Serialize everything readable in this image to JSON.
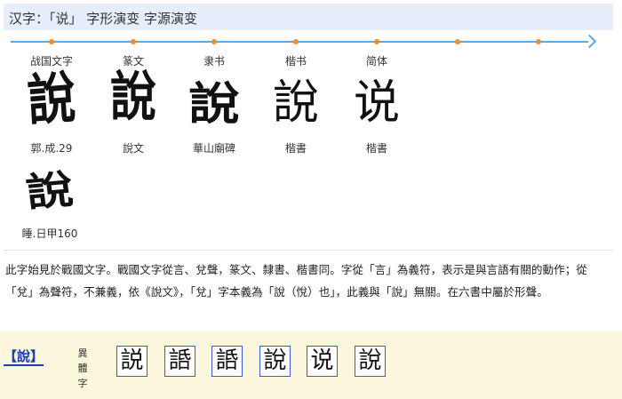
{
  "title": "汉字：「说」 字形演变 字源演变",
  "eras": [
    {
      "label": "战国文字",
      "glyph": "說",
      "source": "郭.成.29"
    },
    {
      "label": "篆文",
      "glyph": "說",
      "source": "說文"
    },
    {
      "label": "隶书",
      "glyph": "說",
      "source": "華山廟碑"
    },
    {
      "label": "楷书",
      "glyph": "說",
      "source": "楷書"
    },
    {
      "label": "简体",
      "glyph": "说",
      "source": "楷書"
    }
  ],
  "extra_glyph": {
    "glyph": "說",
    "source": "睡.日甲160"
  },
  "description": "此字始見於戰國文字。戰國文字從言、兌聲，篆文、隸書、楷書同。字從「言」為義符，表示是與言語有關的動作；從「兌」為聲符，不兼義，依《說文》，「兌」字本義為「說（悅）也」，此義與「說」無關。在六書中屬於形聲。",
  "bottom": {
    "char_link": "【說】",
    "variant_label": "異體字",
    "variants": [
      "説",
      "䛡",
      "䛡",
      "說",
      "说",
      "說"
    ]
  },
  "colors": {
    "accent_line": "#5aa9e6",
    "dot": "#f28c28",
    "link": "#1a3fb0"
  }
}
